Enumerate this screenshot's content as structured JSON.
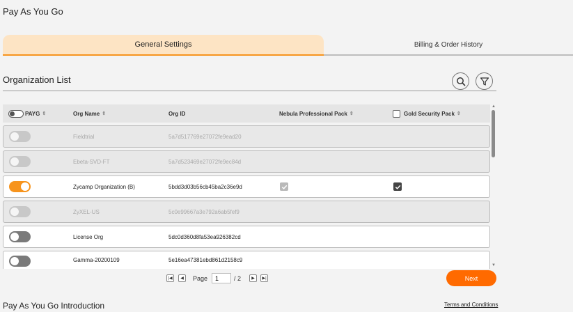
{
  "page": {
    "title": "Pay As You Go"
  },
  "tabs": [
    {
      "label": "General Settings",
      "active": true
    },
    {
      "label": "Billing & Order History",
      "active": false
    }
  ],
  "section": {
    "title": "Organization List"
  },
  "toolbar": {
    "search_icon": "search-icon",
    "filter_icon": "filter-icon"
  },
  "table": {
    "columns": {
      "payg": "PAYG",
      "org_name": "Org Name",
      "org_id": "Org ID",
      "nebula_pack": "Nebula Professional Pack",
      "gold_pack": "Gold Security Pack"
    },
    "rows": [
      {
        "payg": "off",
        "name": "Fieldtrial",
        "id": "5a7d517769e27072fe9ead20",
        "nebula": "none",
        "gold": "none",
        "dim": true
      },
      {
        "payg": "off",
        "name": "Ebeta-SVD-FT",
        "id": "5a7d523469e27072fe9ec84d",
        "nebula": "none",
        "gold": "none",
        "dim": true
      },
      {
        "payg": "on",
        "name": "Zycamp Organization (B)",
        "id": "5bdd3d03b56cb45ba2c36e9d",
        "nebula": "checked-grey",
        "gold": "checked-dark",
        "dim": false
      },
      {
        "payg": "off",
        "name": "ZyXEL-US",
        "id": "5c0e99667a3e792a6ab5fef9",
        "nebula": "none",
        "gold": "none",
        "dim": true
      },
      {
        "payg": "off",
        "name": "License Org",
        "id": "5dc0d360d8fa53ea926382cd",
        "nebula": "none",
        "gold": "none",
        "dim": false
      },
      {
        "payg": "off",
        "name": "Gamma-20200109",
        "id": "5e16ea47381ebd861d2158c9",
        "nebula": "none",
        "gold": "none",
        "dim": false
      }
    ]
  },
  "pagination": {
    "page_label": "Page",
    "current": "1",
    "total": "/ 2"
  },
  "next_label": "Next",
  "footer": {
    "intro_title": "Pay As You Go Introduction",
    "terms_label": "Terms and Conditions"
  },
  "colors": {
    "accent": "#f7941d",
    "next_button": "#ff6a00",
    "tab_active_bg": "#fde4c4"
  }
}
